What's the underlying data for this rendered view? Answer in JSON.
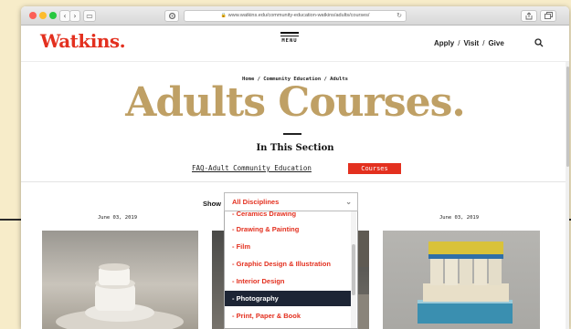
{
  "browser": {
    "back_glyph": "‹",
    "forward_glyph": "›",
    "sidebar_glyph": "▭",
    "url": "www.watkins.edu/community-education-watkins/adults/courses/"
  },
  "site": {
    "logo": "Watkins.",
    "menu_label": "MENU",
    "nav": {
      "apply": "Apply",
      "visit": "Visit",
      "give": "Give",
      "sep": "/"
    }
  },
  "page": {
    "breadcrumb": "Home / Community Education / Adults",
    "title": "Adults Courses.",
    "section_title": "In This Section",
    "faq_link": "FAQ-Adult Community Education",
    "courses_button": "Courses"
  },
  "filter": {
    "show_label": "Show",
    "selected": "All Disciplines",
    "options": [
      "- Ceramics Drawing",
      "- Drawing & Painting",
      "- Film",
      "- Graphic Design & Illustration",
      "- Interior Design",
      "- Photography",
      "- Print, Paper & Book"
    ],
    "highlighted": "- Photography"
  },
  "cards": [
    {
      "date": "June 03, 2019"
    },
    {
      "date": "June 03, 2019"
    }
  ],
  "colors": {
    "brand_red": "#e3301f",
    "title_gold": "#bfa065",
    "highlight_navy": "#1d2535"
  }
}
